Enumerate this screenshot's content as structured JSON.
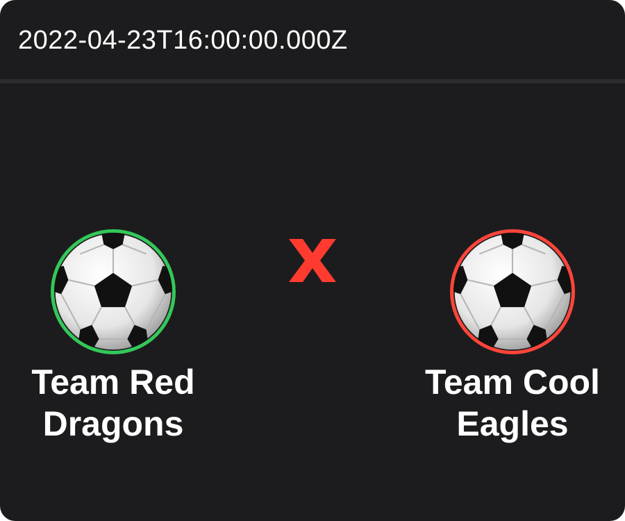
{
  "match": {
    "datetime": "2022-04-23T16:00:00.000Z",
    "separator_icon": "x-icon",
    "separator_color": "#ff3b30"
  },
  "home_team": {
    "name": "Team Red Dragons",
    "icon": "soccer-ball-icon",
    "ring_color": "#34c759"
  },
  "away_team": {
    "name": "Team Cool Eagles",
    "icon": "soccer-ball-icon",
    "ring_color": "#ff453a"
  }
}
